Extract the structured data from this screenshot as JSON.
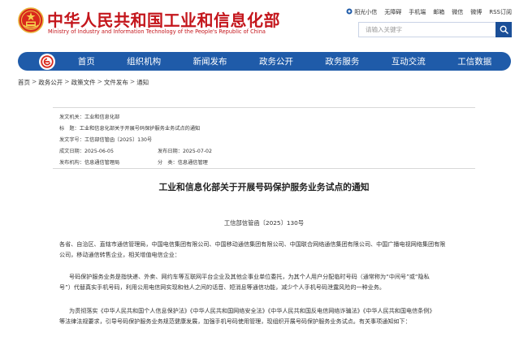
{
  "header": {
    "title": "中华人民共和国工业和信息化部",
    "subtitle": "Ministry of Industry and Information Technology of the People's Republic of China",
    "top_links": [
      "阳光小信",
      "无障碍",
      "手机端",
      "邮箱",
      "微信",
      "微博",
      "RSS订阅"
    ],
    "search_placeholder": "请输入关键字"
  },
  "nav": {
    "items": [
      "首页",
      "组织机构",
      "新闻发布",
      "政务公开",
      "政务服务",
      "互动交流",
      "工信数据"
    ]
  },
  "breadcrumb": [
    "首页",
    "政务公开",
    "政策文件",
    "文件发布",
    "通知"
  ],
  "meta": {
    "issuer_label": "发文机关：",
    "issuer": "工业和信息化部",
    "title_label": "标　题：",
    "title": "工业和信息化部关于开展号码保护服务业务试点的通知",
    "docno_label": "发文字号：",
    "docno": "工信部信管函〔2025〕130号",
    "date_label": "成文日期：",
    "date": "2025-06-05",
    "pubdate_label": "发布日期：",
    "pubdate": "2025-07-02",
    "org_label": "发布机构：",
    "org": "信息通信管理局",
    "category_label": "分　类：",
    "category": "信息通信管理"
  },
  "document": {
    "title": "工业和信息化部关于开展号码保护服务业务试点的通知",
    "number": "工信部信管函〔2025〕130号",
    "p1": [
      "各省、自治区、直辖市通信管理局，中国电信集团有限公司、中国移动通信集团有限公司、中国联合网络通信集团有限公司、中国广播电视网络集团有限",
      "公司，移动通信转售企业，相关增值电信企业："
    ],
    "p2": [
      "号码保护服务业务是指快递、外卖、网约车等互联网平台企业及其他企事业单位委托，为其个人用户分配临时号码（通常称为“中间号”或“隐私",
      "号”）代替真实手机号码，利用公用电信网实现和他人之间的话音、短消息等通信功能，减少个人手机号码泄露风险的一种业务。"
    ],
    "p3": [
      "为贯彻落实《中华人民共和国个人信息保护法》《中华人民共和国网络安全法》《中华人民共和国反电信网络诈骗法》《中华人民共和国电信条例》",
      "等法律法规要求，引导号码保护服务业务规范健康发展，加强手机号码使用管理，现组织开展号码保护服务业务试点。有关事项通知如下："
    ]
  }
}
